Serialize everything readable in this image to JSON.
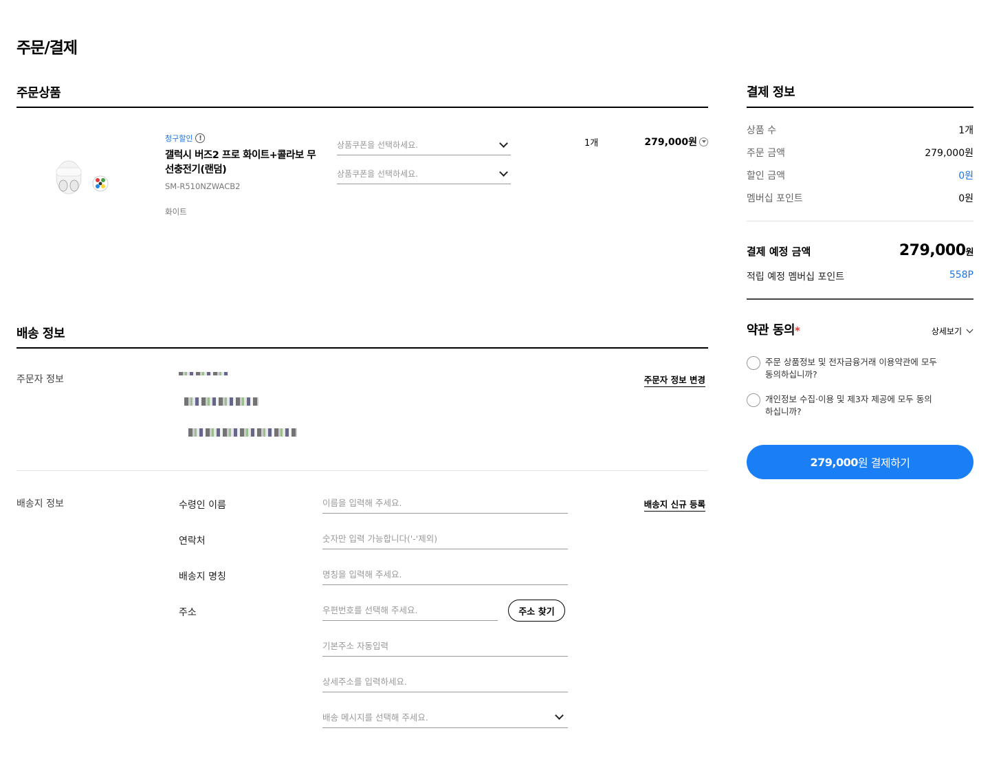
{
  "page_title": "주문/결제",
  "order": {
    "section_title": "주문상품",
    "product": {
      "tag": "청구할인",
      "name": "갤럭시 버즈2 프로 화이트+콜라보 무선충전기(랜덤)",
      "model": "SM-R510NZWACB2",
      "color": "화이트",
      "quantity": "1개",
      "price": "279,000원"
    },
    "coupon_placeholders": [
      "상품쿠폰을 선택하세요.",
      "상품쿠폰을 선택하세요."
    ]
  },
  "delivery": {
    "section_title": "배송 정보",
    "orderer_label": "주문자 정보",
    "change_orderer": "주문자 정보 변경",
    "address_label": "배송지 정보",
    "new_address": "배송지 신규 등록",
    "fields": [
      {
        "label": "수령인 이름",
        "placeholder": "이름을 입력해 주세요."
      },
      {
        "label": "연락처",
        "placeholder": "숫자만 입력 가능합니다('-'제외)"
      },
      {
        "label": "배송지 명칭",
        "placeholder": "명칭을 입력해 주세요."
      },
      {
        "label": "주소",
        "placeholder": "우편번호를 선택해 주세요."
      }
    ],
    "find_address": "주소 찾기",
    "base_address_placeholder": "기본주소 자동입력",
    "detail_address_placeholder": "상세주소를 입력하세요.",
    "message_placeholder": "배송 메시지를 선택해 주세요."
  },
  "payment": {
    "section_title": "결제 정보",
    "rows": [
      {
        "label": "상품 수",
        "value": "1개"
      },
      {
        "label": "주문 금액",
        "value": "279,000원"
      },
      {
        "label": "할인 금액",
        "value": "0원"
      },
      {
        "label": "멤버십 포인트",
        "value": "0원"
      }
    ],
    "total_label": "결제 예정 금액",
    "total_value": "279,000",
    "total_unit": "원",
    "points_label": "적립 예정 멤버십 포인트",
    "points_value": "558P",
    "accent_color": "#1a7ff5"
  },
  "terms": {
    "title": "약관 동의",
    "required_mark": "*",
    "detail_link": "상세보기",
    "items": [
      "주문 상품정보 및 전자금융거래 이용약관에 모두 동의하십니까?",
      "개인정보 수집·이용 및 제3자 제공에 모두 동의하십니까?"
    ]
  },
  "pay_button": {
    "amount": "279,000",
    "label": "원 결제하기"
  }
}
